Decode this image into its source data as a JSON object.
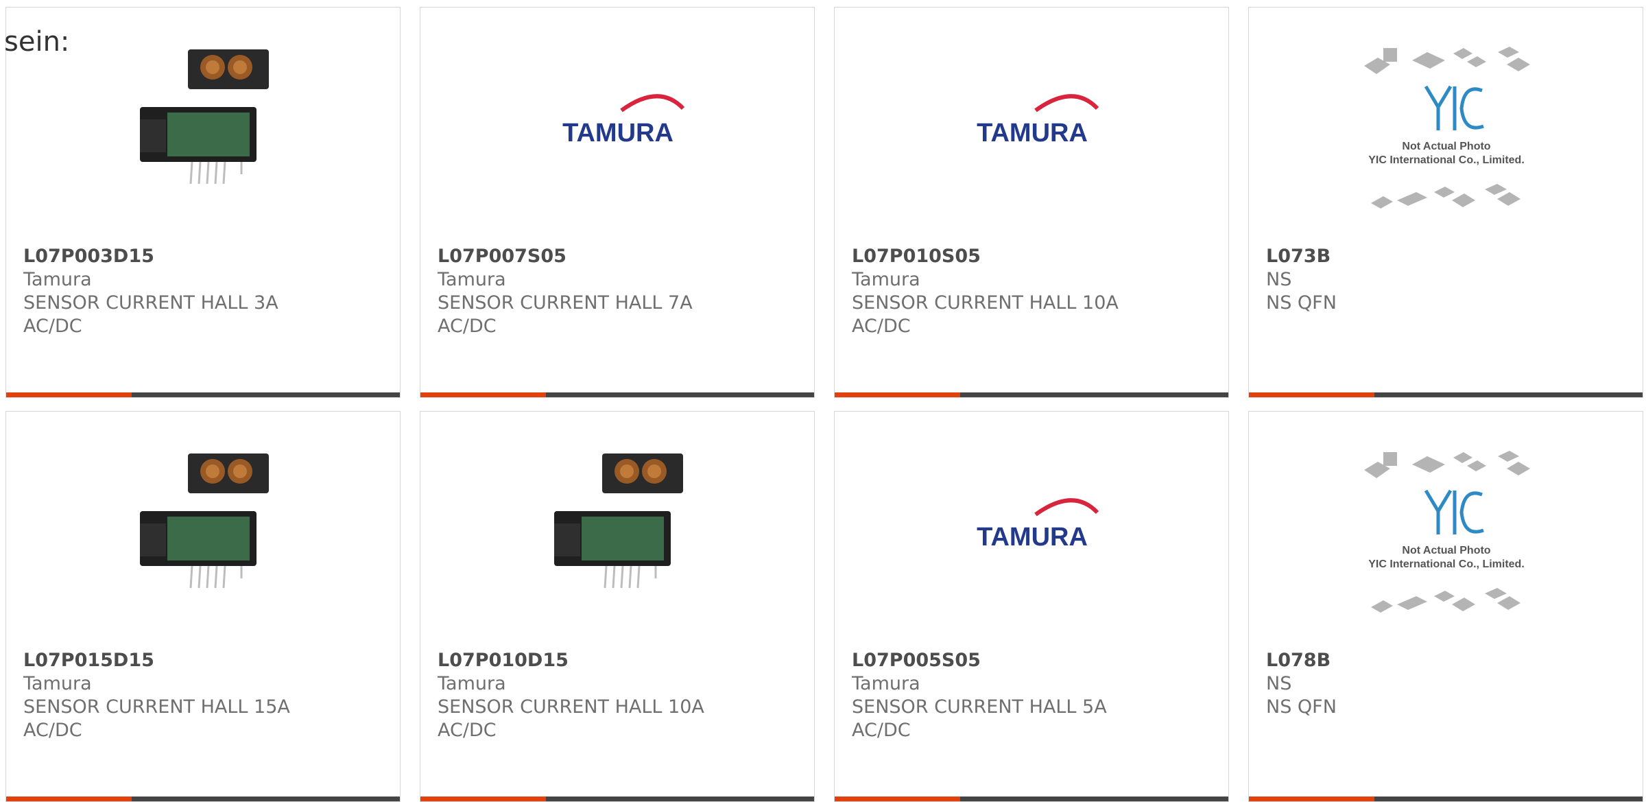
{
  "header": {
    "fragment": "sein:"
  },
  "colors": {
    "accent": "#e2400d",
    "bar": "#444444"
  },
  "cards": [
    {
      "part_number": "L07P003D15",
      "brand": "Tamura",
      "desc1": "SENSOR CURRENT HALL 3A",
      "desc2": "AC/DC",
      "image": "sensor-photo"
    },
    {
      "part_number": "L07P007S05",
      "brand": "Tamura",
      "desc1": "SENSOR CURRENT HALL 7A",
      "desc2": "AC/DC",
      "image": "tamura-logo",
      "logo_text": "TAMURA"
    },
    {
      "part_number": "L07P010S05",
      "brand": "Tamura",
      "desc1": "SENSOR CURRENT HALL 10A",
      "desc2": "AC/DC",
      "image": "tamura-logo",
      "logo_text": "TAMURA"
    },
    {
      "part_number": "L073B",
      "brand": "NS",
      "desc1": "NS QFN",
      "desc2": "",
      "image": "placeholder",
      "placeholder_line1": "Not Actual Photo",
      "placeholder_line2": "YIC International Co., Limited."
    },
    {
      "part_number": "L07P015D15",
      "brand": "Tamura",
      "desc1": "SENSOR CURRENT HALL 15A",
      "desc2": "AC/DC",
      "image": "sensor-photo"
    },
    {
      "part_number": "L07P010D15",
      "brand": "Tamura",
      "desc1": "SENSOR CURRENT HALL 10A",
      "desc2": "AC/DC",
      "image": "sensor-photo"
    },
    {
      "part_number": "L07P005S05",
      "brand": "Tamura",
      "desc1": "SENSOR CURRENT HALL 5A",
      "desc2": "AC/DC",
      "image": "tamura-logo",
      "logo_text": "TAMURA"
    },
    {
      "part_number": "L078B",
      "brand": "NS",
      "desc1": "NS QFN",
      "desc2": "",
      "image": "placeholder",
      "placeholder_line1": "Not Actual Photo",
      "placeholder_line2": "YIC International Co., Limited."
    }
  ]
}
